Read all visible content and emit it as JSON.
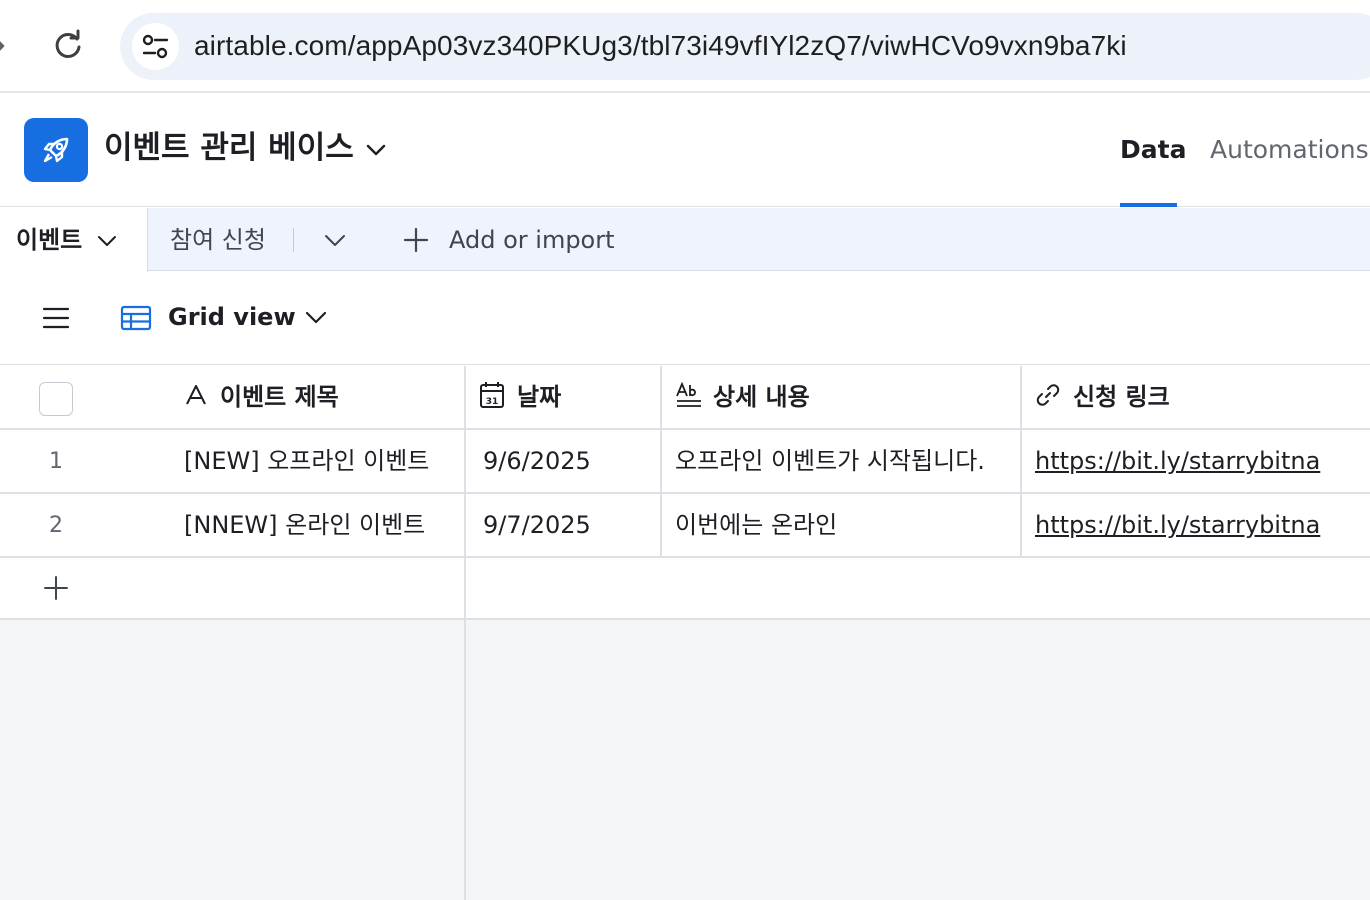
{
  "browser": {
    "url": "airtable.com/appAp03vz340PKUg3/tbl73i49vfIYl2zQ7/viwHCVo9vxn9ba7ki",
    "forward_icon": "forward-arrow-icon",
    "reload_icon": "reload-icon",
    "site_info_icon": "tune-icon"
  },
  "header": {
    "base_title": "이벤트 관리 베이스",
    "logo_icon": "rocket-icon",
    "nav": {
      "data": "Data",
      "automations": "Automations"
    },
    "accent": "#166ee1"
  },
  "tables": {
    "tabs": [
      {
        "label": "이벤트",
        "active": true
      },
      {
        "label": "참여 신청",
        "active": false
      }
    ],
    "add_label": "Add or import"
  },
  "view": {
    "name": "Grid view"
  },
  "grid": {
    "columns": [
      {
        "label": "이벤트 제목",
        "icon": "text-field-icon"
      },
      {
        "label": "날짜",
        "icon": "calendar-icon"
      },
      {
        "label": "상세 내용",
        "icon": "long-text-icon"
      },
      {
        "label": "신청 링크",
        "icon": "link-icon"
      }
    ],
    "rows": [
      {
        "num": "1",
        "title": "[NEW] 오프라인 이벤트",
        "date": "9/6/2025",
        "detail": "오프라인 이벤트가 시작됩니다.",
        "link": "https://bit.ly/starrybitna"
      },
      {
        "num": "2",
        "title": "[NNEW] 온라인 이벤트",
        "date": "9/7/2025",
        "detail": "이번에는 온라인",
        "link": "https://bit.ly/starrybitna"
      }
    ]
  }
}
